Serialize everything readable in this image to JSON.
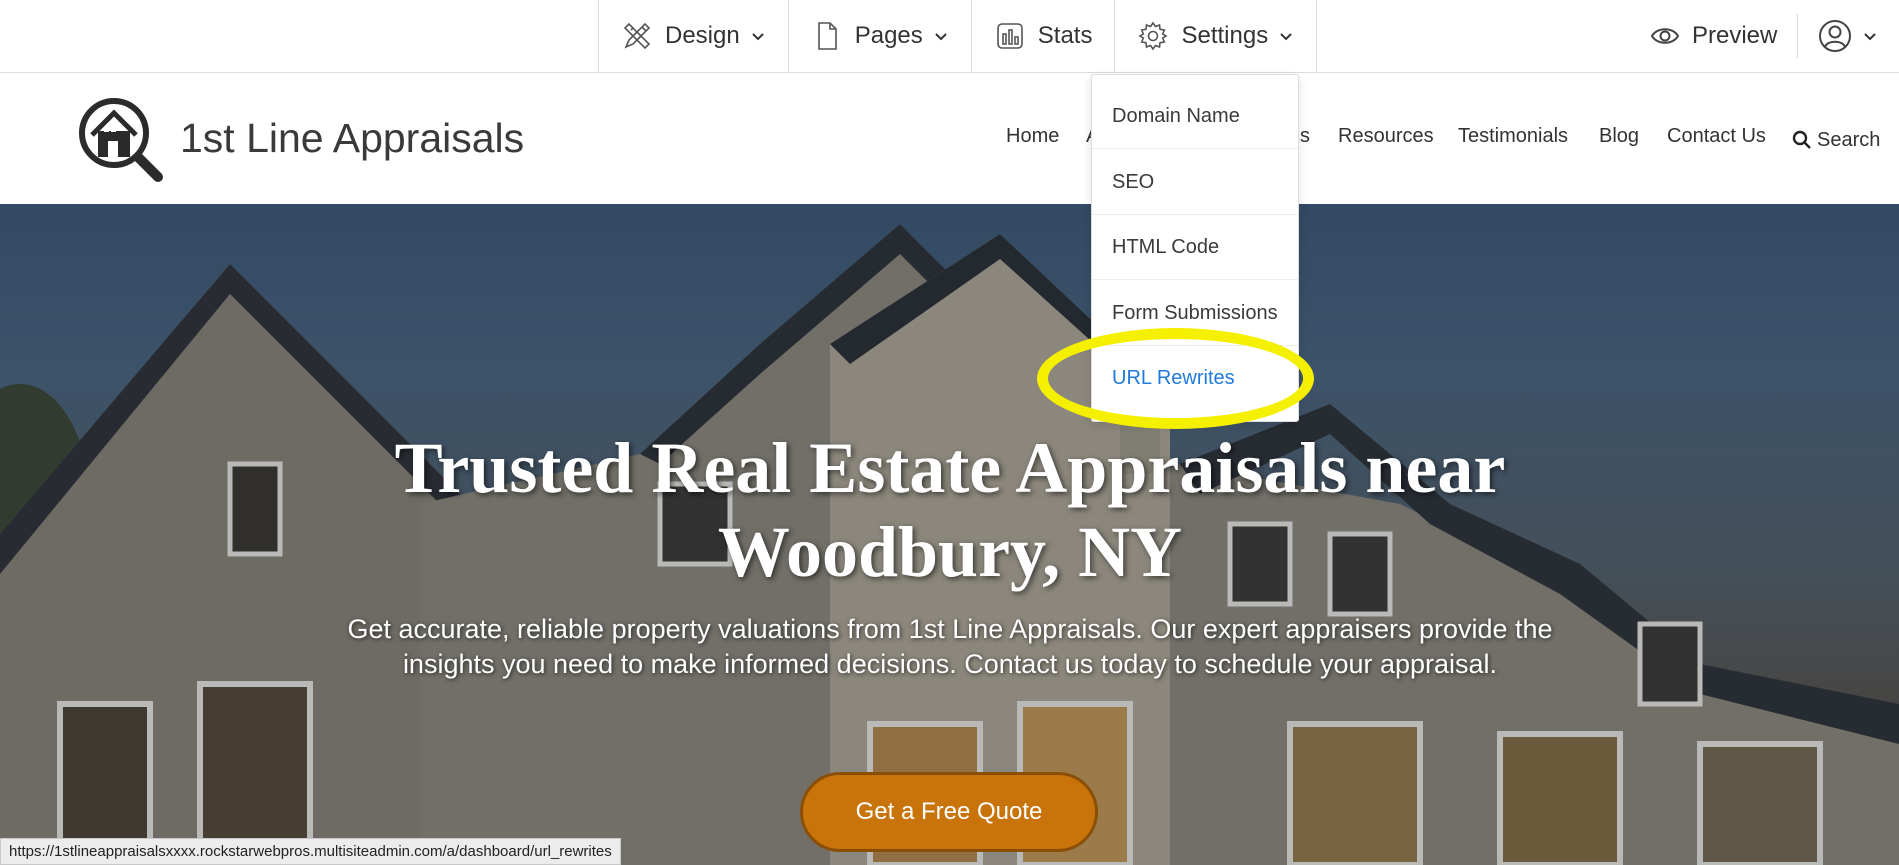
{
  "toolbar": {
    "design_label": "Design",
    "pages_label": "Pages",
    "stats_label": "Stats",
    "settings_label": "Settings",
    "preview_label": "Preview"
  },
  "header": {
    "site_name": "1st Line Appraisals",
    "nav": [
      {
        "label": "Home"
      },
      {
        "label": "A"
      },
      {
        "label": "s"
      },
      {
        "label": "Resources"
      },
      {
        "label": "Testimonials"
      },
      {
        "label": "Blog"
      },
      {
        "label": "Contact Us"
      },
      {
        "label": "Search"
      }
    ]
  },
  "settings_menu": {
    "items": [
      {
        "label": "Domain Name"
      },
      {
        "label": "SEO"
      },
      {
        "label": "HTML Code"
      },
      {
        "label": "Form Submissions"
      },
      {
        "label": "URL Rewrites"
      }
    ]
  },
  "hero": {
    "title_line1": "Trusted Real Estate Appraisals near",
    "title_line2": "Woodbury, NY",
    "subtitle": "Get accurate, reliable property valuations from 1st Line Appraisals. Our expert appraisers provide the insights you need to make informed decisions. Contact us today to schedule your appraisal.",
    "cta_label": "Get a Free Quote"
  },
  "statusbar": {
    "url": "https://1stlineappraisalsxxxx.rockstarwebpros.multisiteadmin.com/a/dashboard/url_rewrites"
  },
  "colors": {
    "accent": "#1f7ad8",
    "cta": "#c8740a",
    "callout": "#f5f000"
  },
  "icons": {
    "design": "pencil-ruler-icon",
    "pages": "document-icon",
    "stats": "bar-chart-icon",
    "settings": "gear-icon",
    "preview": "eye-icon",
    "account": "user-circle-icon",
    "search": "magnifier-icon",
    "logo": "house-magnifier-logo"
  }
}
